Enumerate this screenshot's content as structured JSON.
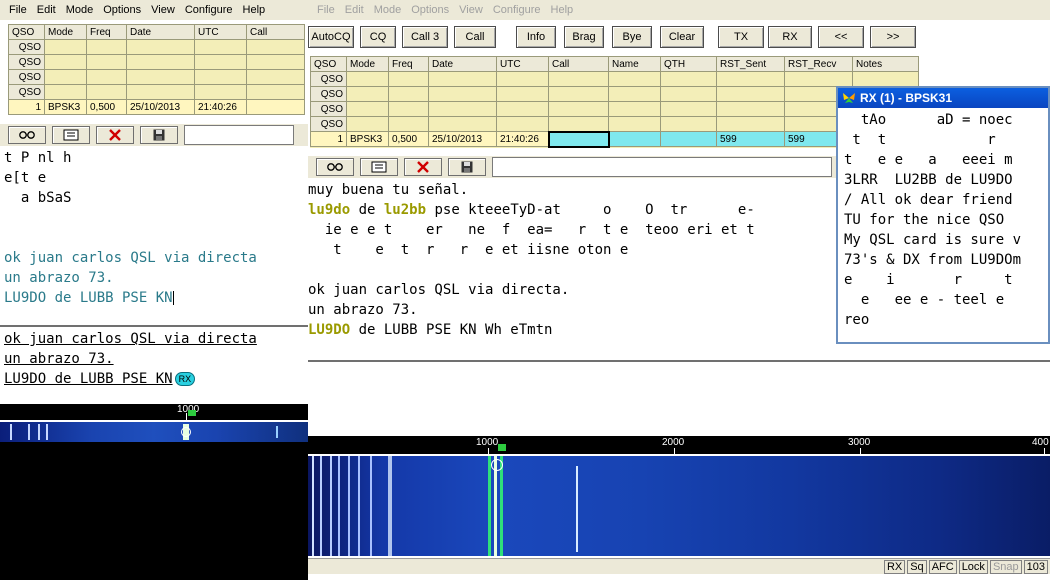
{
  "left": {
    "menu": [
      "File",
      "Edit",
      "Mode",
      "Options",
      "View",
      "Configure",
      "Help"
    ],
    "log": {
      "headers": [
        "QSO",
        "Mode",
        "Freq",
        "Date",
        "UTC",
        "Call"
      ],
      "rows": [
        [
          "QSO",
          "",
          "",
          "",
          "",
          ""
        ],
        [
          "QSO",
          "",
          "",
          "",
          "",
          ""
        ],
        [
          "QSO",
          "",
          "",
          "",
          "",
          ""
        ],
        [
          "QSO",
          "",
          "",
          "",
          "",
          ""
        ],
        [
          "1",
          "BPSK3",
          "0,500",
          "25/10/2013",
          "21:40:26",
          ""
        ]
      ]
    },
    "rx_text": [
      "t P nl h",
      "e[t e",
      "  a bSaS"
    ],
    "tx_echo": [
      "ok juan carlos QSL via directa",
      "un abrazo 73.",
      "LU9DO de LUBB PSE KN"
    ],
    "tx_input": [
      "ok juan carlos QSL via directa",
      "un abrazo 73.",
      "LU9DO de LUBB PSE KN"
    ],
    "rx_badge": "RX",
    "ruler_label": "1000"
  },
  "right": {
    "menu": [
      "File",
      "Edit",
      "Mode",
      "Options",
      "View",
      "Configure",
      "Help"
    ],
    "buttons": [
      "AutoCQ",
      "CQ",
      "Call 3",
      "Call",
      "Info",
      "Brag",
      "Bye",
      "Clear",
      "TX",
      "RX",
      "<<",
      ">>"
    ],
    "log": {
      "headers": [
        "QSO",
        "Mode",
        "Freq",
        "Date",
        "UTC",
        "Call",
        "Name",
        "QTH",
        "RST_Sent",
        "RST_Recv",
        "Notes"
      ],
      "rows": [
        [
          "QSO",
          "",
          "",
          "",
          "",
          "",
          "",
          "",
          "",
          "",
          ""
        ],
        [
          "QSO",
          "",
          "",
          "",
          "",
          "",
          "",
          "",
          "",
          "",
          ""
        ],
        [
          "QSO",
          "",
          "",
          "",
          "",
          "",
          "",
          "",
          "",
          "",
          ""
        ],
        [
          "QSO",
          "",
          "",
          "",
          "",
          "",
          "",
          "",
          "",
          "",
          ""
        ],
        [
          "1",
          "BPSK3",
          "0,500",
          "25/10/2013",
          "21:40:26",
          "",
          "",
          "",
          "599",
          "599",
          ""
        ]
      ]
    },
    "rx_lines": [
      {
        "text": "muy buena tu señal."
      },
      {
        "parts": [
          {
            "t": "lu9do",
            "c": "#9a9a00",
            "b": true
          },
          {
            "t": " de ",
            "c": "#000"
          },
          {
            "t": "lu2bb",
            "c": "#9a9a00",
            "b": true
          },
          {
            "t": " pse kteeeTyD-at     o    O  tr      e-",
            "c": "#000"
          }
        ]
      },
      {
        "text": "  ie e e t    er   ne  f  ea=   r  t e  teoo eri et t"
      },
      {
        "text": "   t    e  t  r   r  e et iisne oton e"
      },
      {
        "text": ""
      },
      {
        "text": "ok juan carlos QSL via directa."
      },
      {
        "text": "un abrazo 73."
      },
      {
        "parts": [
          {
            "t": "LU9DO",
            "c": "#9a9a00",
            "b": true
          },
          {
            "t": " de LUBB PSE KN Wh eTmtn",
            "c": "#000"
          }
        ]
      }
    ],
    "ruler_labels": [
      "1000",
      "2000",
      "3000",
      "400"
    ],
    "status": [
      "RX",
      "Sq",
      "AFC",
      "Lock",
      "Snap",
      "103"
    ]
  },
  "popup": {
    "title": "RX (1) - BPSK31",
    "lines": [
      "  tAo      aD = noec",
      " t  t            r",
      "t   e e   a   eeei m",
      "3LRR  LU2BB de LU9DO",
      "/ All ok dear friend",
      "TU for the nice QSO",
      "My QSL card is sure v",
      "73's & DX from LU9DOm",
      "e    i       r     t",
      "  e   ee e - teel e",
      "reo"
    ]
  },
  "colors": {
    "accent": "#0b5fe0",
    "log_bg": "#f3eeb8",
    "cursor_row": "#7fe8ee",
    "tx_text": "#2a7a8a",
    "callsign": "#9a9a00"
  }
}
